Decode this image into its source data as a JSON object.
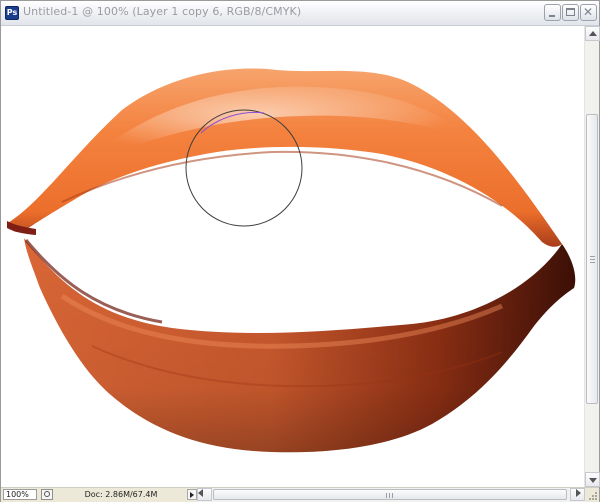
{
  "window": {
    "app_icon": "photoshop-document-icon",
    "title": "Untitled-1 @ 100% (Layer 1 copy 6, RGB/8/CMYK)",
    "controls": [
      "minimize-icon",
      "maximize-icon",
      "close-icon"
    ]
  },
  "canvas": {
    "content": "orange-peel-lips-image",
    "brush_cursor": "brush-circle-cursor"
  },
  "statusbar": {
    "zoom": "100%",
    "doc_info": "Doc: 2.86M/67.4M"
  },
  "colors": {
    "upper_lip": "#f07a3c",
    "lower_lip": "#c4552a",
    "lower_lip_shadow": "#4a1208"
  }
}
